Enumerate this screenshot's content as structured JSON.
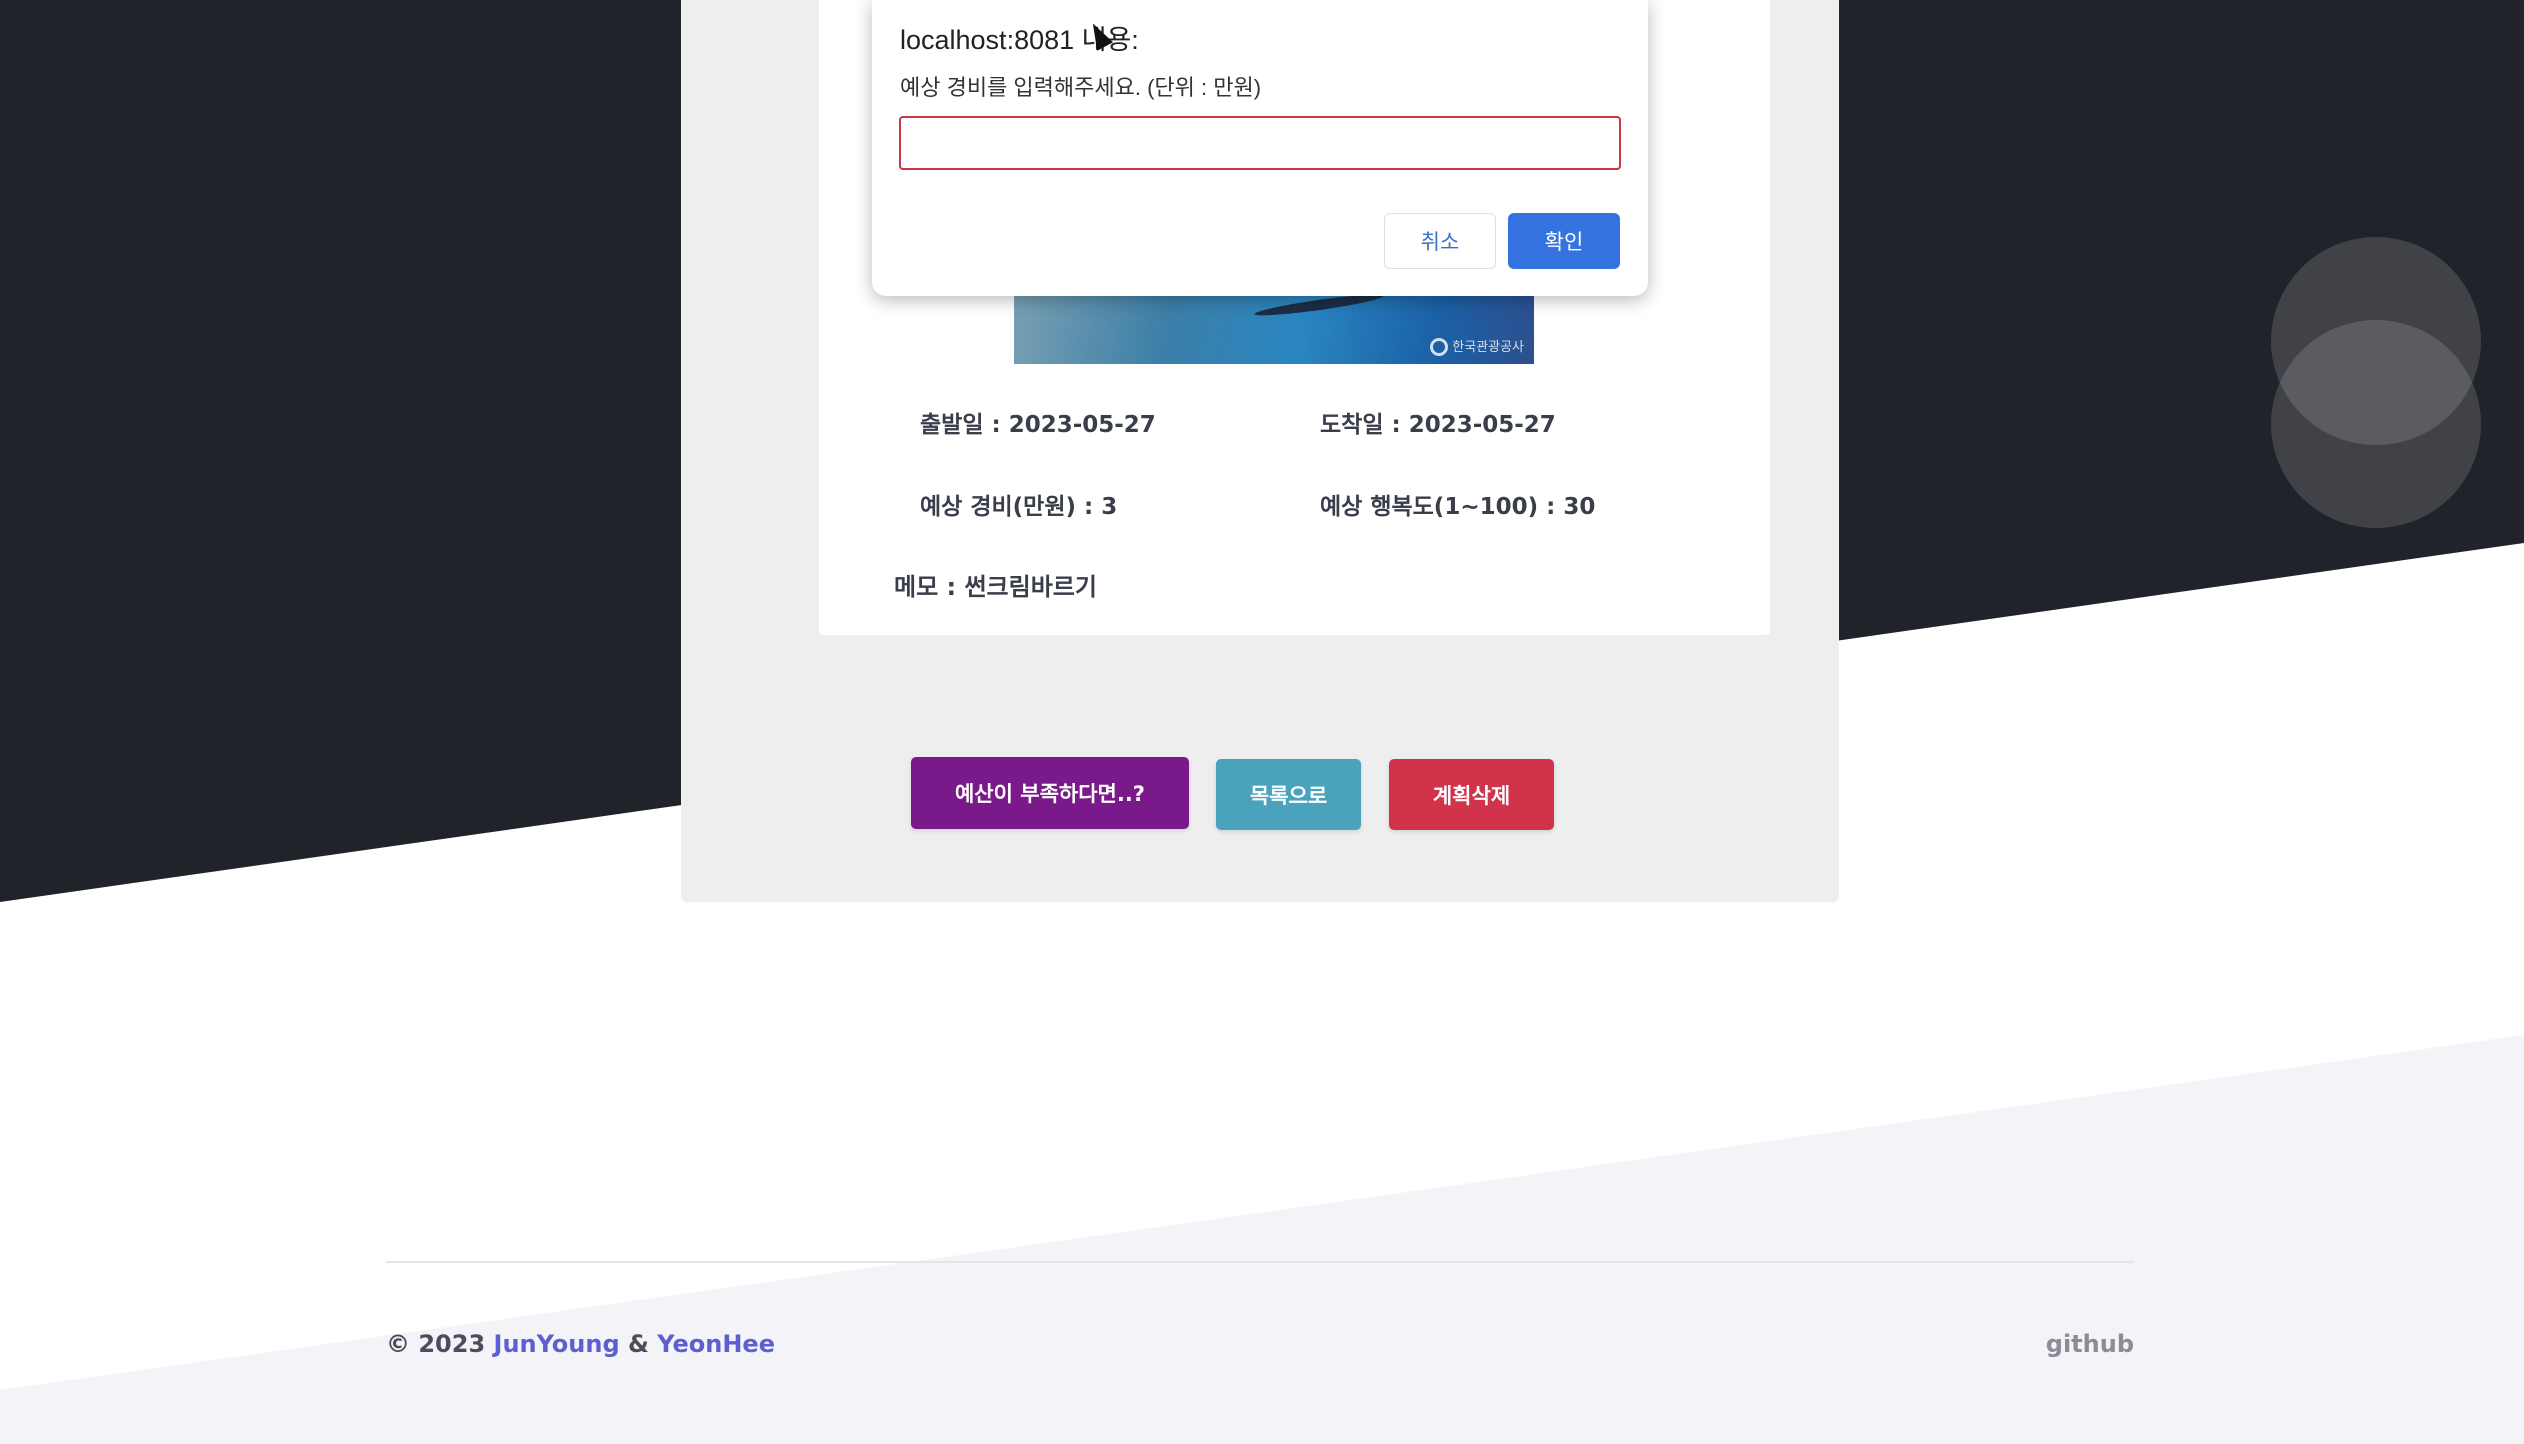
{
  "dialog": {
    "title": "localhost:8081 내용:",
    "message": "예상 경비를 입력해주세요. (단위 : 만원)",
    "input_value": "",
    "cancel_label": "취소",
    "ok_label": "확인"
  },
  "plan": {
    "thumbnail_watermark": "한국관광공사",
    "start_date": "출발일 : 2023-05-27",
    "end_date": "도착일 : 2023-05-27",
    "budget": "예상 경비(만원) : 3",
    "happiness": "예상 행복도(1~100) : 30",
    "memo": "메모 : 썬크림바르기"
  },
  "actions": {
    "budget_help_label": "예산이 부족하다면..?",
    "list_label": "목록으로",
    "delete_label": "계획삭제"
  },
  "footer": {
    "copyright": "© 2023",
    "author1": "JunYoung",
    "ampersand": "&",
    "author2": "YeonHee",
    "github_label": "github"
  },
  "colors": {
    "dark_bg": "#21232b",
    "purple_button": "#7a1a8a",
    "teal_button": "#4aa3bd",
    "red_button": "#d0334a",
    "dialog_ok": "#3573e0",
    "link": "#5b5fd0"
  }
}
